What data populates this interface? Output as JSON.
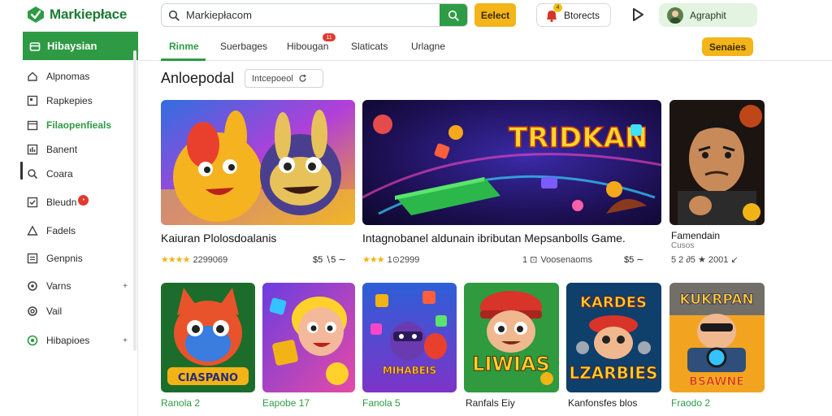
{
  "brand": {
    "name": "Markiepłace"
  },
  "search": {
    "value": "Markiepłacom"
  },
  "topbar": {
    "select_label": "Eelect",
    "notif_label": "Btorects",
    "notif_badge": "4",
    "profile_name": "Agraphit"
  },
  "sidebar": {
    "header": "Hibaysian",
    "items": [
      {
        "label": "Alpnomas",
        "icon": "home-icon"
      },
      {
        "label": "Rapkepies",
        "icon": "grid-icon"
      },
      {
        "label": "Filaopenfieals",
        "icon": "calendar-icon",
        "active": true
      },
      {
        "label": "Banent",
        "icon": "chart-icon"
      },
      {
        "label": "Coara",
        "icon": "search-icon"
      },
      {
        "label": "Bleudn",
        "icon": "checkbox-icon",
        "badge": "•"
      },
      {
        "label": "Fadels",
        "icon": "triangle-icon"
      },
      {
        "label": "Genpnis",
        "icon": "list-icon"
      },
      {
        "label": "Varns",
        "icon": "gear-icon",
        "arrow": "+"
      },
      {
        "label": "Vail",
        "icon": "circle-icon"
      },
      {
        "label": "Hibapioes",
        "icon": "plus-circle-icon",
        "arrow": "+"
      }
    ]
  },
  "tabs": [
    {
      "label": "Rinme",
      "active": true
    },
    {
      "label": "Suerbages"
    },
    {
      "label": "Hibougan",
      "badge": "11"
    },
    {
      "label": "Slaticats"
    },
    {
      "label": "Urlagne"
    }
  ],
  "tab_cta": "Senaies",
  "section": {
    "title": "Anloepodal",
    "filter": "Intcepoeol"
  },
  "featured": [
    {
      "title": "Kaiuran Plolosdoalanis",
      "rating": "2299069",
      "price": "$5 ∖5 ∼"
    },
    {
      "title": "Intagnobanel aldunain ibributan Mepsanbolls Game.",
      "count": "1 ⊡",
      "rating": "1⊙2999",
      "meta": "Voosenaoms",
      "price": "$5 ∼"
    },
    {
      "title": "Famendain",
      "sub": "Cusos",
      "meta": "5 2 ∂5 ★ 2001 ↙"
    }
  ],
  "grid": [
    {
      "title": "Ranola 2",
      "green": true
    },
    {
      "title": "Eapobe 17",
      "green": true
    },
    {
      "title": "Fanola 5",
      "green": true
    },
    {
      "title": "Ranfals Eiy",
      "green": false
    },
    {
      "title": "Kanfonsfes blos",
      "green": false
    },
    {
      "title": "Fraodo 2",
      "green": true
    }
  ],
  "colors": {
    "accent": "#2e9a44",
    "cta": "#f3b519",
    "badge": "#e23a2f"
  }
}
